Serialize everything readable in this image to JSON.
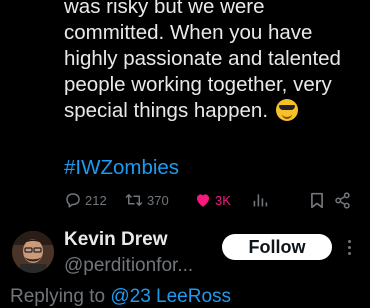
{
  "tweet": {
    "lines": [
      "was risky but we were",
      "committed. When you have",
      "highly passionate and talented",
      "people working together, very",
      "special things happen."
    ],
    "emoji": "smiling-face-with-sunglasses",
    "hashtag": "#IWZombies"
  },
  "actions": {
    "replies": "212",
    "reposts": "370",
    "likes": "3K",
    "liked": true
  },
  "reply": {
    "author_name": "Kevin Drew",
    "author_handle": "@perditionfor...",
    "follow_label": "Follow",
    "replying_prefix": "Replying to ",
    "replying_mentions": "@23 LeeRoss"
  },
  "colors": {
    "background": "#000000",
    "text": "#e7e9ea",
    "muted": "#71767b",
    "link": "#1d9bf0",
    "like": "#f91880"
  }
}
